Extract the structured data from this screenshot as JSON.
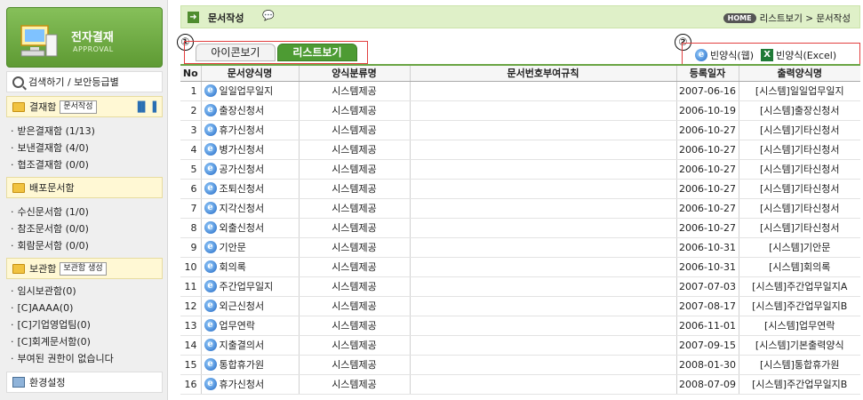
{
  "sidebar": {
    "logo_title": "전자결재",
    "logo_sub": "APPROVAL",
    "search_label": "검색하기 / 보안등급별",
    "sections": [
      {
        "title": "결재함",
        "tag": "문서작성",
        "items": [
          "받은결재함 (1/13)",
          "보낸결재함 (4/0)",
          "협조결재함 (0/0)"
        ]
      },
      {
        "title": "배포문서함",
        "tag": "",
        "items": [
          "수신문서함 (1/0)",
          "참조문서함 (0/0)",
          "회람문서함 (0/0)"
        ]
      },
      {
        "title": "보관함",
        "tag": "보관함 생성",
        "items": [
          "임시보관함(0)",
          "[C]AAAA(0)",
          "[C]기업영업팀(0)",
          "[C]회계문서함(0)",
          "부여된 권한이 없습니다"
        ]
      }
    ],
    "settings_label": "환경설정"
  },
  "header": {
    "title": "문서작성",
    "home": "HOME",
    "breadcrumb": "리스트보기 > 문서작성"
  },
  "tabs": {
    "icon_view": "아이콘보기",
    "list_view": "리스트보기"
  },
  "markers": {
    "one": "①",
    "two": "②"
  },
  "blank_buttons": {
    "web": "빈양식(웹)",
    "excel": "빈양식(Excel)"
  },
  "table": {
    "columns": [
      "No",
      "문서양식명",
      "양식분류명",
      "문서번호부여규칙",
      "등록일자",
      "출력양식명"
    ],
    "rows": [
      {
        "no": "1",
        "name": "일일업무일지",
        "category": "시스템제공",
        "rule": "",
        "date": "2007-06-16",
        "output": "[시스템]일일업무일지"
      },
      {
        "no": "2",
        "name": "출장신청서",
        "category": "시스템제공",
        "rule": "",
        "date": "2006-10-19",
        "output": "[시스템]출장신청서"
      },
      {
        "no": "3",
        "name": "휴가신청서",
        "category": "시스템제공",
        "rule": "",
        "date": "2006-10-27",
        "output": "[시스템]기타신청서"
      },
      {
        "no": "4",
        "name": "병가신청서",
        "category": "시스템제공",
        "rule": "",
        "date": "2006-10-27",
        "output": "[시스템]기타신청서"
      },
      {
        "no": "5",
        "name": "공가신청서",
        "category": "시스템제공",
        "rule": "",
        "date": "2006-10-27",
        "output": "[시스템]기타신청서"
      },
      {
        "no": "6",
        "name": "조퇴신청서",
        "category": "시스템제공",
        "rule": "",
        "date": "2006-10-27",
        "output": "[시스템]기타신청서"
      },
      {
        "no": "7",
        "name": "지각신청서",
        "category": "시스템제공",
        "rule": "",
        "date": "2006-10-27",
        "output": "[시스템]기타신청서"
      },
      {
        "no": "8",
        "name": "외출신청서",
        "category": "시스템제공",
        "rule": "",
        "date": "2006-10-27",
        "output": "[시스템]기타신청서"
      },
      {
        "no": "9",
        "name": "기안문",
        "category": "시스템제공",
        "rule": "",
        "date": "2006-10-31",
        "output": "[시스템]기안문"
      },
      {
        "no": "10",
        "name": "회의록",
        "category": "시스템제공",
        "rule": "",
        "date": "2006-10-31",
        "output": "[시스템]회의록"
      },
      {
        "no": "11",
        "name": "주간업무일지",
        "category": "시스템제공",
        "rule": "",
        "date": "2007-07-03",
        "output": "[시스템]주간업무일지A"
      },
      {
        "no": "12",
        "name": "외근신청서",
        "category": "시스템제공",
        "rule": "",
        "date": "2007-08-17",
        "output": "[시스템]주간업무일지B"
      },
      {
        "no": "13",
        "name": "업무연락",
        "category": "시스템제공",
        "rule": "",
        "date": "2006-11-01",
        "output": "[시스템]업무연락"
      },
      {
        "no": "14",
        "name": "지출결의서",
        "category": "시스템제공",
        "rule": "",
        "date": "2007-09-15",
        "output": "[시스템]기본출력양식"
      },
      {
        "no": "15",
        "name": "통합휴가원",
        "category": "시스템제공",
        "rule": "",
        "date": "2008-01-30",
        "output": "[시스템]통합휴가원"
      },
      {
        "no": "16",
        "name": "휴가신청서",
        "category": "시스템제공",
        "rule": "",
        "date": "2008-07-09",
        "output": "[시스템]주간업무일지B"
      }
    ]
  },
  "colors": {
    "accent": "#4d9b33",
    "header_bg": "#dff0c8",
    "marker": "#e24040"
  }
}
